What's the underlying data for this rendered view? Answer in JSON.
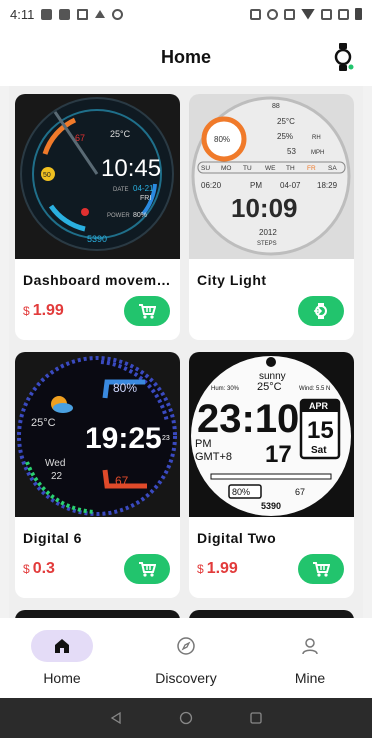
{
  "status_bar": {
    "time": "4:11"
  },
  "header": {
    "title": "Home"
  },
  "cards": [
    {
      "name": "Dashboard movem…",
      "currency": "$",
      "price": "1.99",
      "action": "cart",
      "face": {
        "temp": "25°C",
        "time": "10:45",
        "date_label": "DATE",
        "date": "04-21",
        "day": "FRI",
        "battery_label": "POWER",
        "battery": "80%",
        "steps": "5390",
        "badge": "50",
        "num67": "67"
      }
    },
    {
      "name": "City Light",
      "currency": "",
      "price": "",
      "action": "install",
      "face": {
        "heart": "88",
        "temp": "25°C",
        "humidity": "25%",
        "hum_unit": "RH",
        "wind": "53",
        "wind_unit": "MPH",
        "battery": "80%",
        "days": [
          "SU",
          "MO",
          "TU",
          "WE",
          "TH",
          "FR",
          "SA"
        ],
        "sunrise": "06:20",
        "ampm": "PM",
        "date": "04-07",
        "sunset": "18:29",
        "time": "10:09",
        "steps": "2012",
        "steps_label": "STEPS"
      }
    },
    {
      "name": "Digital 6",
      "currency": "$",
      "price": "0.3",
      "action": "cart",
      "face": {
        "pct": "80%",
        "temp": "25°C",
        "time": "19:25",
        "seconds": "23",
        "day": "Wed",
        "date": "22",
        "heart": "67"
      }
    },
    {
      "name": "Digital Two",
      "currency": "$",
      "price": "1.99",
      "action": "cart",
      "face": {
        "weather": "sunny",
        "temp": "25°C",
        "hum": "Hum: 30%",
        "wind": "Wind: 5.5 N",
        "time": "23:10",
        "ampm": "PM",
        "tz": "GMT+8",
        "day_num": "17",
        "month": "APR",
        "date": "15",
        "weekday": "Sat",
        "battery": "80%",
        "heart": "67",
        "steps": "5390"
      }
    }
  ],
  "bottom_nav": [
    {
      "label": "Home",
      "icon": "home-icon",
      "active": true
    },
    {
      "label": "Discovery",
      "icon": "compass-icon",
      "active": false
    },
    {
      "label": "Mine",
      "icon": "person-icon",
      "active": false
    }
  ],
  "colors": {
    "accent_green": "#22c46d",
    "price_red": "#e23b3b",
    "active_pill": "#e4dcf7"
  }
}
